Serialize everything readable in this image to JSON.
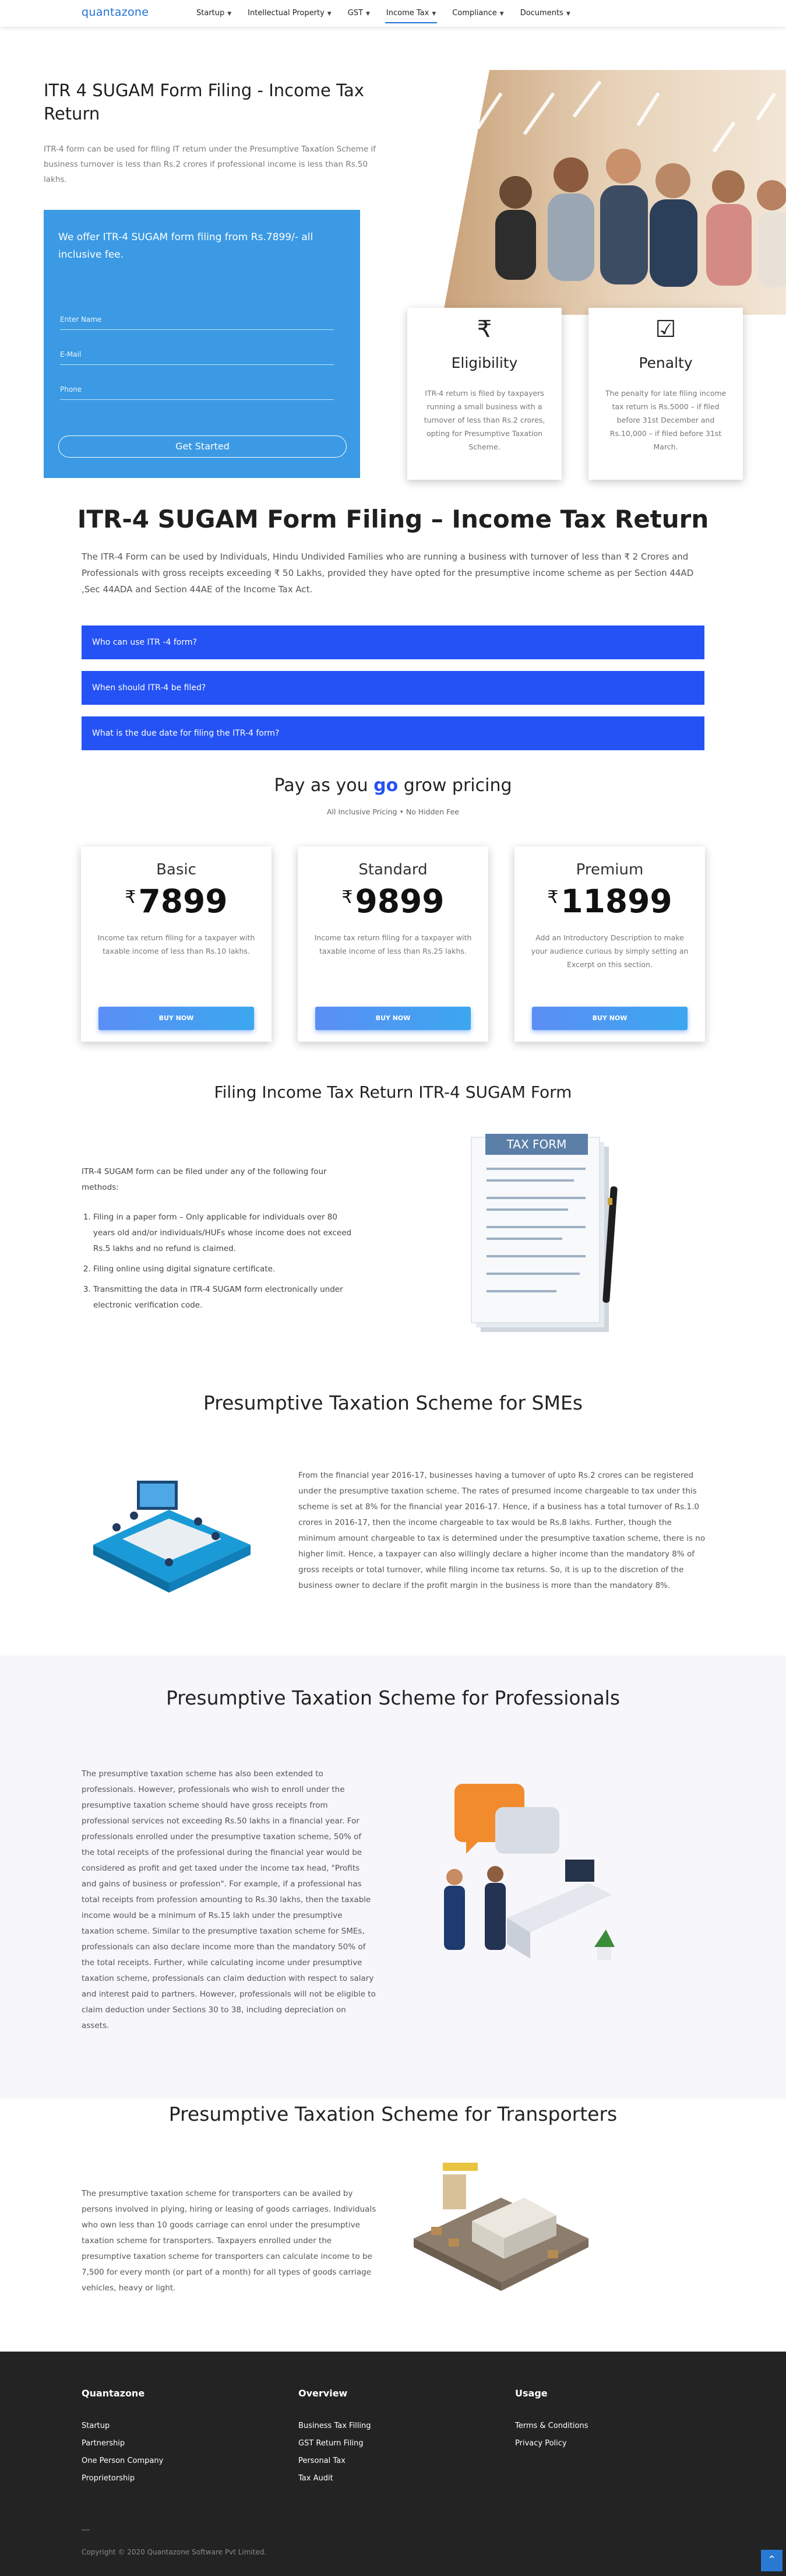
{
  "brand": "quantazone",
  "nav": [
    {
      "label": "Startup",
      "chevron": true,
      "active": false
    },
    {
      "label": "Intellectual Property",
      "chevron": true,
      "active": false
    },
    {
      "label": "GST",
      "chevron": true,
      "active": false
    },
    {
      "label": "Income Tax",
      "chevron": true,
      "active": true
    },
    {
      "label": "Compliance",
      "chevron": true,
      "active": false
    },
    {
      "label": "Documents",
      "chevron": true,
      "active": false
    }
  ],
  "hero": {
    "title": "ITR 4 SUGAM Form Filing - Income Tax Return",
    "lead": "ITR-4 form can be used for filing IT return under the Presumptive Taxation Scheme if business turnover is less than Rs.2 crores if professional income is less than Rs.50 lakhs.",
    "offer": "We offer ITR-4 SUGAM form filing from Rs.7899/- all inclusive fee.",
    "fields": [
      {
        "placeholder": "Enter Name"
      },
      {
        "placeholder": "E-Mail"
      },
      {
        "placeholder": "Phone"
      }
    ],
    "cta": "Get Started"
  },
  "features": [
    {
      "icon": "rupee-icon",
      "glyph": "₹",
      "title": "Eligibility",
      "text": "ITR-4 return is filed by taxpayers running a small business with a turnover of less than Rs.2 crores, opting for Presumptive Taxation Scheme."
    },
    {
      "icon": "checkbox-icon",
      "glyph": "☑",
      "title": "Penalty",
      "text": "The penalty for late filing income tax return is Rs.5000 – if filed before 31st December and Rs.10,000 – if filed before 31st March."
    }
  ],
  "intro": {
    "title": "ITR-4 SUGAM Form Filing – Income Tax Return",
    "text": "The ITR-4 Form can be used by Individuals, Hindu Undivided Families who are running a business with turnover of less than ₹ 2 Crores and Professionals with gross receipts exceeding ₹ 50 Lakhs, provided they have opted for the presumptive income scheme as per Section 44AD ,Sec 44ADA and Section 44AE of the Income Tax Act."
  },
  "faq": [
    "Who can use ITR -4 form?",
    "When should ITR-4 be filed?",
    "What is the due date for filing the ITR-4 form?"
  ],
  "pricing": {
    "title_pre": "Pay as you ",
    "title_go": "go",
    "title_post": " grow pricing",
    "subtitle": "All Inclusive Pricing • No Hidden Fee",
    "currency": "₹",
    "plans": [
      {
        "name": "Basic",
        "price": "7899",
        "desc": "Income tax return filing for a taxpayer with taxable income of less than Rs.10 lakhs.",
        "button": "BUY NOW"
      },
      {
        "name": "Standard",
        "price": "9899",
        "desc": "Income tax return filing for a taxpayer with taxable income of less than Rs.25 lakhs.",
        "button": "BUY NOW"
      },
      {
        "name": "Premium",
        "price": "11899",
        "desc": "Add an Introductory Description to make your audience curious by simply setting an Excerpt on this section.",
        "button": "BUY NOW"
      }
    ]
  },
  "filing": {
    "title": "Filing Income Tax Return ITR-4 SUGAM Form",
    "intro": "ITR-4 SUGAM form can be filed under any of the following four methods:",
    "methods": [
      "Filing in a paper form – Only applicable for individuals over 80 years old and/or individuals/HUFs whose income does not exceed Rs.5 lakhs and no refund is claimed.",
      "Filing online using digital signature certificate.",
      "Transmitting the data in ITR-4 SUGAM form electronically under electronic verification code."
    ],
    "image_label": "TAX FORM"
  },
  "smes": {
    "title": "Presumptive Taxation Scheme for SMEs",
    "text": "From the financial year 2016-17, businesses having a turnover of upto Rs.2 crores can be registered under the presumptive taxation scheme. The rates of presumed income chargeable to tax under this scheme is set at 8% for the financial year 2016-17. Hence, if a business has a total turnover of Rs.1.0 crores in 2016-17, then the income chargeable to tax would be Rs.8 lakhs. Further, though the minimum amount chargeable to tax is determined under the presumptive taxation scheme, there is no higher limit. Hence, a taxpayer can also willingly declare a higher income than the mandatory 8% of gross receipts or total turnover, while filing income tax returns. So, it is up to the discretion of the business owner to declare if the profit margin in the business is more than the mandatory 8%."
  },
  "professionals": {
    "title": "Presumptive Taxation Scheme for Professionals",
    "text": "The presumptive taxation scheme has also been extended to professionals. However, professionals who wish to enroll under the presumptive taxation scheme should have gross receipts from professional services not exceeding Rs.50 lakhs in a financial year. For professionals enrolled under the presumptive taxation scheme, 50% of the total receipts of the professional during the financial year would be considered as profit and get taxed under the income tax head, \"Profits and gains of business or profession\". For example, if a professional has total receipts from profession amounting to Rs.30 lakhs, then the taxable income would be a minimum of Rs.15 lakh under the presumptive taxation scheme. Similar to the presumptive taxation scheme for SMEs, professionals can also declare income more than the mandatory 50% of the total receipts. Further, while calculating income under presumptive taxation scheme, professionals can claim deduction with respect to salary and interest paid to partners. However, professionals will not be eligible to claim deduction under Sections 30 to 38, including depreciation on assets."
  },
  "transporters": {
    "title": "Presumptive Taxation Scheme for Transporters",
    "text": "The presumptive taxation scheme for transporters can be availed by persons involved in plying, hiring or leasing of goods carriages. Individuals who own less than 10 goods carriage can enrol under the presumptive taxation scheme for transporters. Taxpayers enrolled under the presumptive taxation scheme for transporters can calculate income to be 7,500 for every month (or part of a month) for all types of goods carriage vehicles, heavy or light."
  },
  "footer": {
    "columns": [
      {
        "heading": "Quantazone",
        "links": [
          "Startup",
          "Partnership",
          "One Person Company",
          "Proprietorship"
        ]
      },
      {
        "heading": "Overview",
        "links": [
          "Business Tax Filling",
          "GST Return Filing",
          "Personal Tax",
          "Tax Audit"
        ]
      },
      {
        "heading": "Usage",
        "links": [
          "Terms & Conditions",
          "Privacy Policy"
        ]
      }
    ],
    "copyright": "Copyright © 2020 Quantazone Software Pvt Limited."
  },
  "colors": {
    "accent": "#1f6fd6",
    "form_bg": "#3b9ae3",
    "faq_bg": "#2452f4",
    "footer_bg": "#232323",
    "pricing_go": "#2452f4"
  }
}
